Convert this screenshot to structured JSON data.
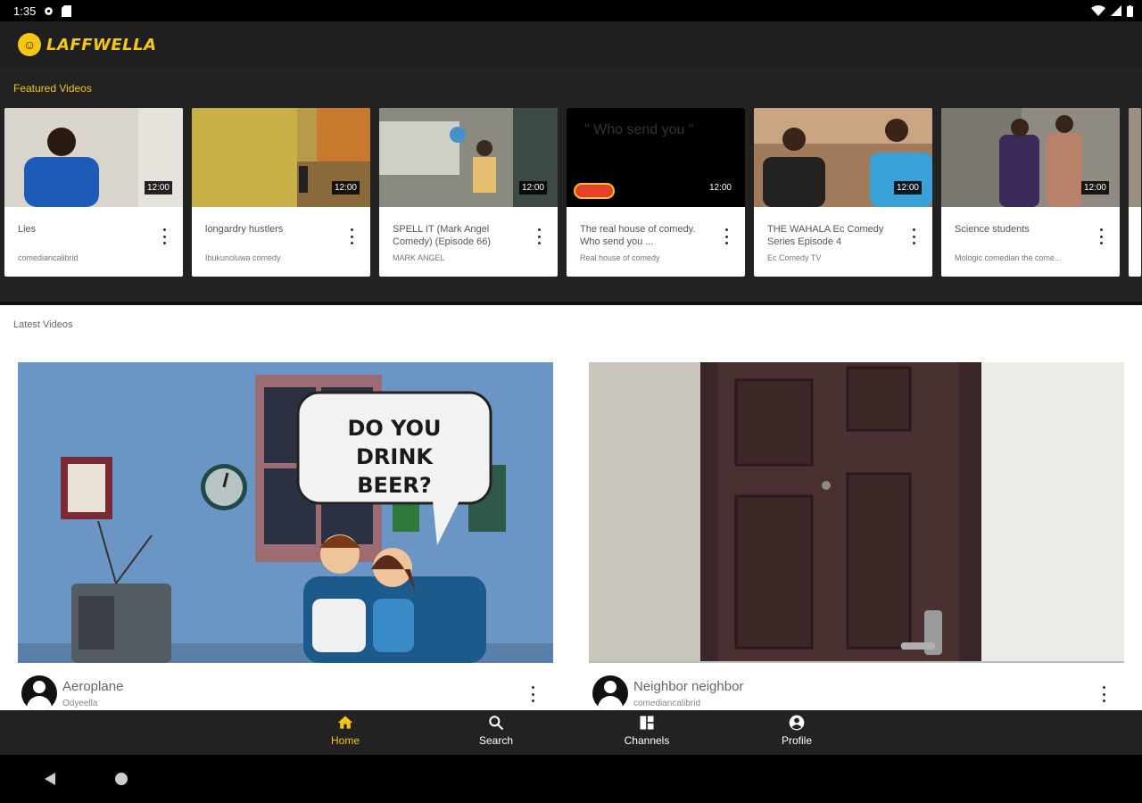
{
  "status_bar": {
    "time": "1:35"
  },
  "app": {
    "logo_text": "LAFFWELLA",
    "brand_color": "#f5c518"
  },
  "featured": {
    "title": "Featured Videos",
    "items": [
      {
        "title": "Lies",
        "channel": "comediancalibrid",
        "duration": "12:00"
      },
      {
        "title": "longardry hustlers",
        "channel": "Ibukunoluwa comedy",
        "duration": "12:00"
      },
      {
        "title": "SPELL IT (Mark Angel Comedy) (Episode 66)",
        "channel": "MARK ANGEL",
        "duration": "12:00"
      },
      {
        "title": "The real house of comedy. Who send you ...",
        "channel": "Real house of comedy",
        "duration": "12:00",
        "overlay_text": "\" Who send you \""
      },
      {
        "title": "THE WAHALA Ec Comedy Series Episode 4",
        "channel": "Ec Comedy TV",
        "duration": "12:00"
      },
      {
        "title": "Science students",
        "channel": "Mologic comedian the come...",
        "duration": "12:00"
      }
    ]
  },
  "latest": {
    "title": "Latest Videos",
    "items": [
      {
        "title": "Aeroplane",
        "channel": "Odyeella",
        "bubble_text": "DO YOU DRINK BEER?"
      },
      {
        "title": "Neighbor neighbor",
        "channel": "comediancalibrid"
      }
    ]
  },
  "bottom_nav": {
    "items": [
      {
        "label": "Home",
        "icon": "home-icon",
        "active": true
      },
      {
        "label": "Search",
        "icon": "search-icon",
        "active": false
      },
      {
        "label": "Channels",
        "icon": "channels-icon",
        "active": false
      },
      {
        "label": "Profile",
        "icon": "profile-icon",
        "active": false
      }
    ]
  }
}
